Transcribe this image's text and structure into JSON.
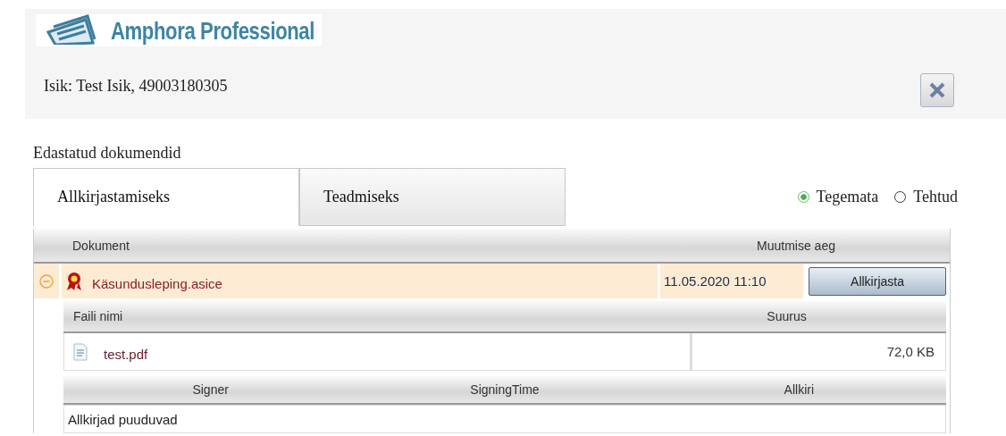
{
  "logo": {
    "text": "Amphora Professional"
  },
  "person": "Isik: Test Isik, 49003180305",
  "section_title": "Edastatud dokumendid",
  "tabs": [
    {
      "label": "Allkirjastamiseks",
      "selected": true
    },
    {
      "label": "Teadmiseks",
      "selected": false
    }
  ],
  "filter": [
    {
      "label": "Tegemata",
      "selected": true
    },
    {
      "label": "Tehtud",
      "selected": false
    }
  ],
  "documents": {
    "columns": [
      "Dokument",
      "Muutmise aeg"
    ],
    "rows": [
      {
        "name": "Käsundusleping.asice",
        "modified": "11.05.2020 11:10",
        "action": "Allkirjasta",
        "expanded": true,
        "files": {
          "columns": [
            "Faili nimi",
            "Suurus"
          ],
          "rows": [
            {
              "name": "test.pdf",
              "size": "72,0 KB"
            }
          ]
        },
        "signatures": {
          "columns": [
            "Signer",
            "SigningTime",
            "Allkiri"
          ],
          "empty_text": "Allkirjad puuduvad"
        }
      }
    ]
  }
}
